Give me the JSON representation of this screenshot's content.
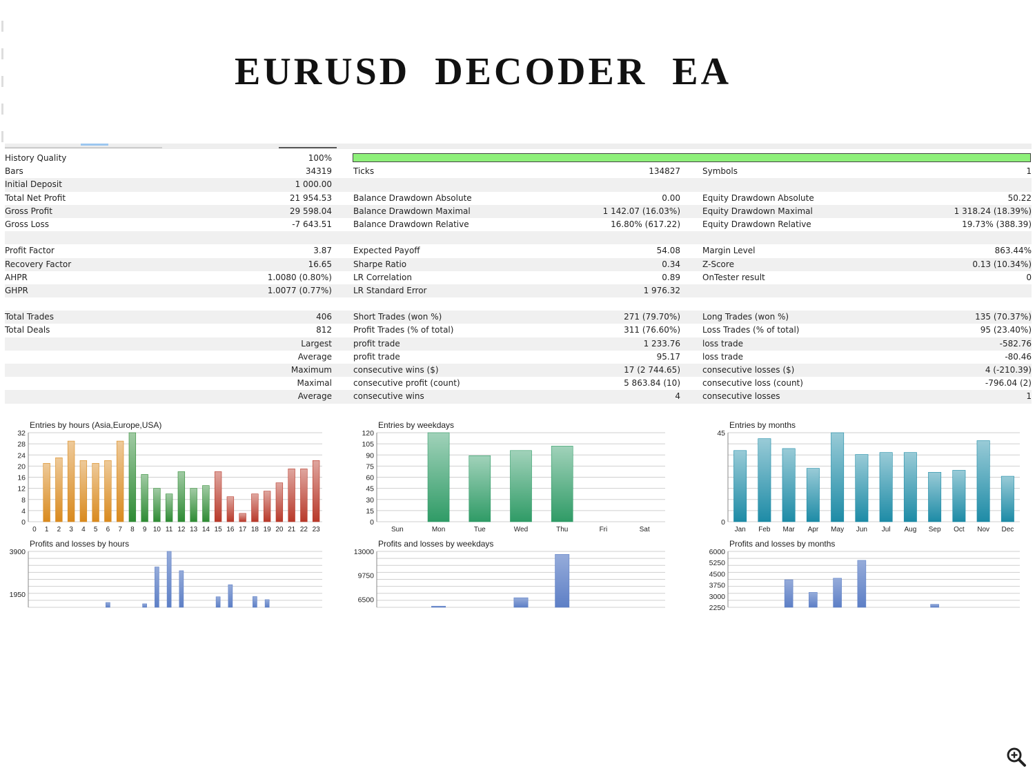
{
  "title": "EURUSD  DECODER  EA",
  "report": {
    "history_quality": {
      "label": "History Quality",
      "value": "100%"
    },
    "rows": [
      {
        "c1": "Bars",
        "v1": "34319",
        "c2": "Ticks",
        "v2": "134827",
        "c3": "Symbols",
        "v3": "1",
        "shade": false
      },
      {
        "c1": "Initial Deposit",
        "v1": "1 000.00",
        "c2": "",
        "v2": "",
        "c3": "",
        "v3": "",
        "shade": true
      },
      {
        "c1": "Total Net Profit",
        "v1": "21 954.53",
        "c2": "Balance Drawdown Absolute",
        "v2": "0.00",
        "c3": "Equity Drawdown Absolute",
        "v3": "50.22",
        "shade": false
      },
      {
        "c1": "Gross Profit",
        "v1": "29 598.04",
        "c2": "Balance Drawdown Maximal",
        "v2": "1 142.07 (16.03%)",
        "c3": "Equity Drawdown Maximal",
        "v3": "1 318.24 (18.39%)",
        "shade": true
      },
      {
        "c1": "Gross Loss",
        "v1": "-7 643.51",
        "c2": "Balance Drawdown Relative",
        "v2": "16.80% (617.22)",
        "c3": "Equity Drawdown Relative",
        "v3": "19.73% (388.39)",
        "shade": false
      },
      {
        "c1": "",
        "v1": "",
        "c2": "",
        "v2": "",
        "c3": "",
        "v3": "",
        "shade": true
      },
      {
        "c1": "Profit Factor",
        "v1": "3.87",
        "c2": "Expected Payoff",
        "v2": "54.08",
        "c3": "Margin Level",
        "v3": "863.44%",
        "shade": false
      },
      {
        "c1": "Recovery Factor",
        "v1": "16.65",
        "c2": "Sharpe Ratio",
        "v2": "0.34",
        "c3": "Z-Score",
        "v3": "0.13 (10.34%)",
        "shade": true
      },
      {
        "c1": "AHPR",
        "v1": "1.0080 (0.80%)",
        "c2": "LR Correlation",
        "v2": "0.89",
        "c3": "OnTester result",
        "v3": "0",
        "shade": false
      },
      {
        "c1": "GHPR",
        "v1": "1.0077 (0.77%)",
        "c2": "LR Standard Error",
        "v2": "1 976.32",
        "c3": "",
        "v3": "",
        "shade": true
      },
      {
        "c1": "",
        "v1": "",
        "c2": "",
        "v2": "",
        "c3": "",
        "v3": "",
        "shade": false
      },
      {
        "c1": "Total Trades",
        "v1": "406",
        "c2": "Short Trades (won %)",
        "v2": "271 (79.70%)",
        "c3": "Long Trades (won %)",
        "v3": "135 (70.37%)",
        "shade": true
      },
      {
        "c1": "Total Deals",
        "v1": "812",
        "c2": "Profit Trades (% of total)",
        "v2": "311 (76.60%)",
        "c3": "Loss Trades (% of total)",
        "v3": "95 (23.40%)",
        "shade": false
      },
      {
        "c1r": "Largest",
        "c2": "profit trade",
        "v2": "1 233.76",
        "c3": "loss trade",
        "v3": "-582.76",
        "shade": true
      },
      {
        "c1r": "Average",
        "c2": "profit trade",
        "v2": "95.17",
        "c3": "loss trade",
        "v3": "-80.46",
        "shade": false
      },
      {
        "c1r": "Maximum",
        "c2": "consecutive wins ($)",
        "v2": "17 (2 744.65)",
        "c3": "consecutive losses ($)",
        "v3": "4 (-210.39)",
        "shade": true
      },
      {
        "c1r": "Maximal",
        "c2": "consecutive profit (count)",
        "v2": "5 863.84 (10)",
        "c3": "consecutive loss (count)",
        "v3": "-796.04 (2)",
        "shade": false
      },
      {
        "c1r": "Average",
        "c2": "consecutive wins",
        "v2": "4",
        "c3": "consecutive losses",
        "v3": "1",
        "shade": true
      },
      {
        "c1": "",
        "v1": "",
        "c2": "",
        "v2": "",
        "c3": "",
        "v3": "",
        "shade": false
      }
    ]
  },
  "chart_data": [
    {
      "id": "entries-hours",
      "type": "bar",
      "title": "Entries by hours (Asia,Europe,USA)",
      "categories": [
        "0",
        "1",
        "2",
        "3",
        "4",
        "5",
        "6",
        "7",
        "8",
        "9",
        "10",
        "11",
        "12",
        "13",
        "14",
        "15",
        "16",
        "17",
        "18",
        "19",
        "20",
        "21",
        "22",
        "23"
      ],
      "values": [
        0,
        21,
        23,
        29,
        22,
        21,
        22,
        29,
        32,
        17,
        12,
        10,
        18,
        12,
        13,
        18,
        9,
        3,
        10,
        11,
        14,
        19,
        19,
        22
      ],
      "ylim": [
        0,
        32
      ],
      "yticks": [
        0,
        4,
        8,
        12,
        16,
        20,
        24,
        28,
        32
      ],
      "colors": [
        "#d98a1e",
        "#d98a1e",
        "#d98a1e",
        "#d98a1e",
        "#d98a1e",
        "#d98a1e",
        "#d98a1e",
        "#d98a1e",
        "#2e8b34",
        "#2e8b34",
        "#2e8b34",
        "#2e8b34",
        "#2e8b34",
        "#2e8b34",
        "#2e8b34",
        "#b8392a",
        "#b8392a",
        "#b8392a",
        "#b8392a",
        "#b8392a",
        "#b8392a",
        "#b8392a",
        "#b8392a",
        "#b8392a"
      ]
    },
    {
      "id": "entries-weekdays",
      "type": "bar",
      "title": "Entries by weekdays",
      "categories": [
        "Sun",
        "Mon",
        "Tue",
        "Wed",
        "Thu",
        "Fri",
        "Sat"
      ],
      "values": [
        0,
        120,
        89,
        96,
        102,
        0,
        0
      ],
      "ylim": [
        0,
        120
      ],
      "yticks": [
        0,
        15,
        30,
        45,
        60,
        75,
        90,
        105,
        120
      ],
      "color": "#2f9b66"
    },
    {
      "id": "entries-months",
      "type": "bar",
      "title": "Entries by months",
      "categories": [
        "Jan",
        "Feb",
        "Mar",
        "Apr",
        "May",
        "Jun",
        "Jul",
        "Aug",
        "Sep",
        "Oct",
        "Nov",
        "Dec"
      ],
      "values": [
        36,
        42,
        37,
        27,
        45,
        34,
        35,
        35,
        25,
        26,
        41,
        23
      ],
      "ylim": [
        0,
        45
      ],
      "yticks": [
        0,
        45
      ],
      "color": "#1d8ba6"
    },
    {
      "id": "pl-hours",
      "type": "bar",
      "title": "Profits and losses by hours",
      "categories": [
        "0",
        "1",
        "2",
        "3",
        "4",
        "5",
        "6",
        "7",
        "8",
        "9",
        "10",
        "11",
        "12",
        "13",
        "14",
        "15",
        "16",
        "17",
        "18",
        "19",
        "20",
        "21",
        "22",
        "23"
      ],
      "values": [
        0,
        0,
        0,
        0,
        0,
        0,
        1570,
        0,
        0,
        1510,
        3190,
        3900,
        3020,
        0,
        0,
        1830,
        2380,
        0,
        1840,
        1700,
        0,
        0,
        0,
        0
      ],
      "ylim": [
        1350,
        3900
      ],
      "yticks": [
        1950,
        3900
      ],
      "color": "#5d7fc6"
    },
    {
      "id": "pl-weekdays",
      "type": "bar",
      "title": "Profits and losses by weekdays",
      "categories": [
        "Sun",
        "Mon",
        "Tue",
        "Wed",
        "Thu",
        "Fri",
        "Sat"
      ],
      "values": [
        0,
        5560,
        0,
        6700,
        12600,
        0,
        0
      ],
      "ylim": [
        5400,
        13000
      ],
      "yticks": [
        6500,
        9750,
        13000
      ],
      "color": "#5d7fc6"
    },
    {
      "id": "pl-months",
      "type": "bar",
      "title": "Profits and losses by months",
      "categories": [
        "Jan",
        "Feb",
        "Mar",
        "Apr",
        "May",
        "Jun",
        "Jul",
        "Aug",
        "Sep",
        "Oct",
        "Nov",
        "Dec"
      ],
      "values": [
        0,
        0,
        4100,
        3250,
        4200,
        5400,
        0,
        0,
        2450,
        0,
        0,
        0
      ],
      "ylim": [
        2250,
        6000
      ],
      "yticks": [
        2250,
        3000,
        3750,
        4500,
        5250,
        6000
      ],
      "color": "#5d7fc6"
    }
  ]
}
